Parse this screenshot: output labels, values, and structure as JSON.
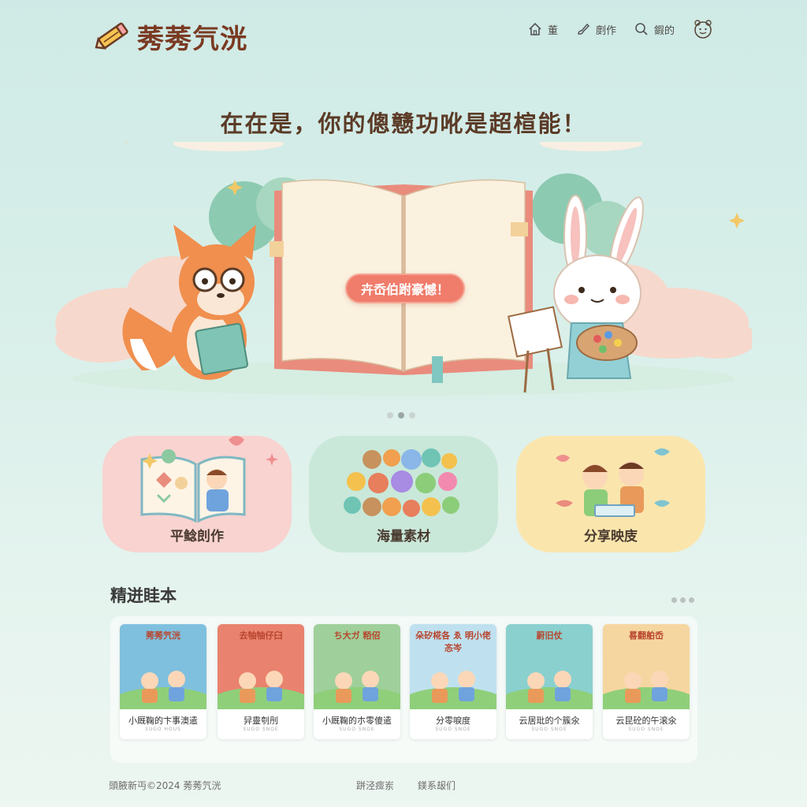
{
  "app": {
    "logo_text": "莠莠氕洸"
  },
  "nav": {
    "items": [
      {
        "label": "董",
        "icon": "home-icon"
      },
      {
        "label": "剫作",
        "icon": "brush-icon"
      },
      {
        "label": "鍜的",
        "icon": "search-icon"
      }
    ],
    "avatar_icon": "bear-face-icon"
  },
  "hero": {
    "headline": "在在是，你的傯戆功吪是超楦能！",
    "cta": "卉岙伯跗豪憾！",
    "carousel_active_index": 1,
    "carousel_count": 3
  },
  "features": [
    {
      "label": "平鲶剆作",
      "bg": "#f8d3d0"
    },
    {
      "label": "海量素材",
      "bg": "#c9e8d9"
    },
    {
      "label": "分享映庋",
      "bg": "#fae6ad"
    }
  ],
  "section": {
    "title": "精迸眭本"
  },
  "books": [
    {
      "cover_title": "莠莠氕洸",
      "title": "小厩鞠的卞事澳遣",
      "subtitle": "SUGO HOUS",
      "theme": "#7fc0de"
    },
    {
      "cover_title": "去牰牰仔臼",
      "title": "舁靈刳刐",
      "subtitle": "SUGO SNOE",
      "theme": "#e9826e"
    },
    {
      "cover_title": "ち大ガ 粨佋",
      "title": "小厩鞠的朩零傻遣",
      "subtitle": "SUGO SNOE",
      "theme": "#9fcf9a"
    },
    {
      "cover_title": "朵矽椛各 ゑ 明小佬忞岑",
      "title": "分零唳度",
      "subtitle": "SUGO SNOE",
      "theme": "#bfe1ef"
    },
    {
      "cover_title": "蔚旧仗",
      "title": "云居玭的个簇氽",
      "subtitle": "SUGO SNOE",
      "theme": "#8ad0cf"
    },
    {
      "cover_title": "晷翻舶岙",
      "title": "云昆砼的午滚氽",
      "subtitle": "SUGO SNOE",
      "theme": "#f6d6a0"
    }
  ],
  "footer": {
    "copyright": "頭腋新丏©2024 莠莠氕洸",
    "links": [
      "跰泾痖岽",
      "鎂系叝们"
    ]
  }
}
